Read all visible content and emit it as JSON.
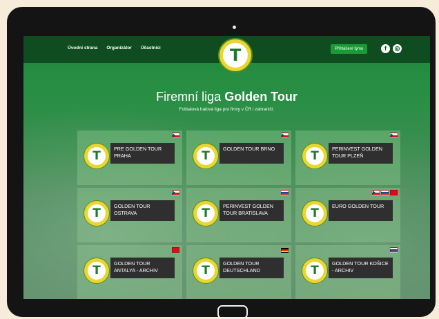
{
  "nav": {
    "links": [
      "Úvodní strana",
      "Organizátor",
      "Účastníci"
    ],
    "login": "Přihlášení týmu",
    "social": [
      {
        "icon": "facebook-icon",
        "glyph": "f"
      },
      {
        "icon": "instagram-icon",
        "glyph": "◎"
      }
    ]
  },
  "hero": {
    "title_plain": "Firemní liga ",
    "title_bold": "Golden Tour",
    "subtitle": "Fotbalová halová liga pro firmy v ČR i zahraničí."
  },
  "logo_letter": "T",
  "tiles": [
    {
      "label": "PRE GOLDEN TOUR PRAHA",
      "flags": [
        "cz"
      ]
    },
    {
      "label": "GOLDEN TOUR BRNO",
      "flags": [
        "cz"
      ]
    },
    {
      "label": "PERINVEST GOLDEN TOUR PLZEŇ",
      "flags": [
        "cz"
      ]
    },
    {
      "label": "GOLDEN TOUR OSTRAVA",
      "flags": [
        "cz"
      ]
    },
    {
      "label": "PERINVEST GOLDEN TOUR BRATISLAVA",
      "flags": [
        "sk"
      ]
    },
    {
      "label": "EURO GOLDEN TOUR",
      "flags": [
        "cz",
        "sk",
        "tr"
      ]
    },
    {
      "label": "GOLDEN TOUR ANTALYA - ARCHIV",
      "flags": [
        "tr"
      ]
    },
    {
      "label": "GOLDEN TOUR DEUTSCHLAND",
      "flags": [
        "de"
      ]
    },
    {
      "label": "GOLDEN TOUR KOŠICE - ARCHIV",
      "flags": [
        "sk"
      ]
    }
  ]
}
